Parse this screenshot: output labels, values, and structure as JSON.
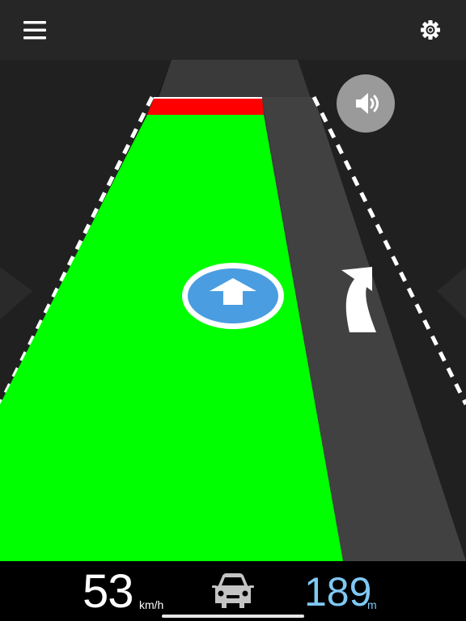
{
  "icons": {
    "menu": "hamburger-menu-icon",
    "settings": "gear-icon",
    "sound": "speaker-icon",
    "direction": "straight-arrow-icon",
    "lane_arrow": "keep-left-arrow-icon",
    "car": "car-icon"
  },
  "colors": {
    "active_lane": "#00ff00",
    "stop_line": "#ff0000",
    "distance_text": "#7fc8f4",
    "direction_badge": "#4a9de0"
  },
  "dashboard": {
    "speed_value": "53",
    "speed_unit": "km/h",
    "distance_value": "189",
    "distance_unit": "m"
  }
}
